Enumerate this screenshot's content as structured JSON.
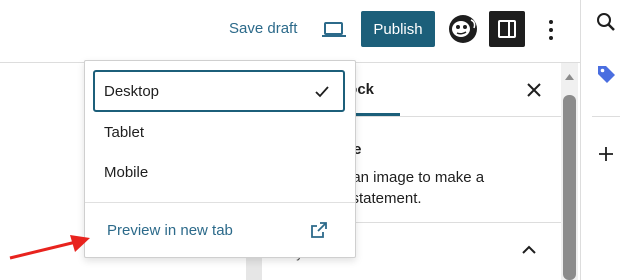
{
  "toolbar": {
    "save_draft_label": "Save draft",
    "publish_label": "Publish",
    "device_icon": "laptop-icon",
    "avatar_icon": "user-avatar-icon",
    "sidebar_toggle_icon": "sidebar-toggle-icon",
    "more_icon": "more-vertical-icon"
  },
  "device_menu": {
    "items": [
      {
        "label": "Desktop",
        "selected": true
      },
      {
        "label": "Tablet",
        "selected": false
      },
      {
        "label": "Mobile",
        "selected": false
      }
    ],
    "preview_label": "Preview in new tab",
    "check_icon": "check-icon",
    "external_icon": "external-link-icon"
  },
  "settings_panel": {
    "tab_label": "lock",
    "block_title": "ge",
    "block_description": "t an image to make a\nl statement.",
    "section_title": "Styles"
  },
  "edge_panel": {
    "icons": [
      "search-icon",
      "tag-icon",
      "plus-icon"
    ]
  },
  "colors": {
    "accent": "#1c5f7a",
    "link": "#2c6a8a",
    "annotation_arrow": "#e8231e"
  }
}
